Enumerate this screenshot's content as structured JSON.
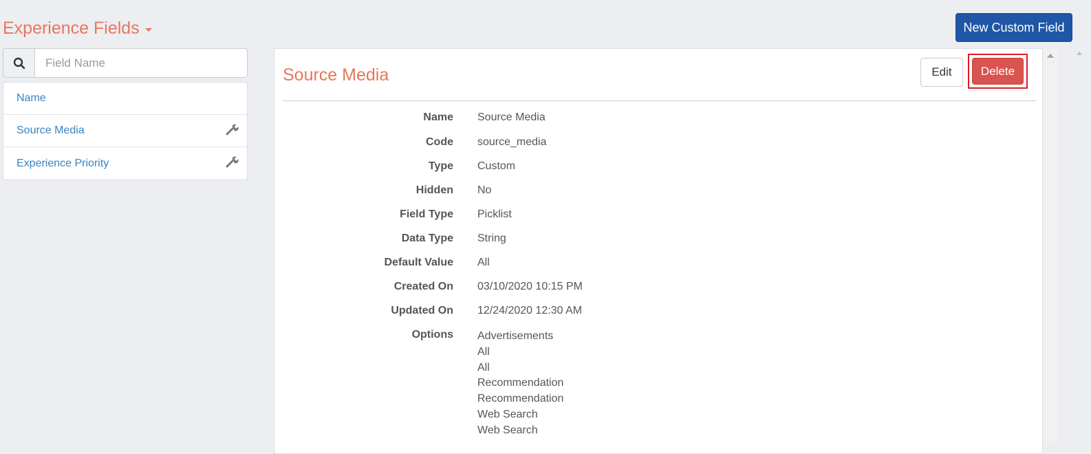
{
  "header": {
    "section_title": "Experience Fields",
    "new_button_label": "New Custom Field"
  },
  "sidebar": {
    "search_placeholder": "Field Name",
    "items": [
      {
        "label": "Name",
        "has_wrench": false
      },
      {
        "label": "Source Media",
        "has_wrench": true
      },
      {
        "label": "Experience Priority",
        "has_wrench": true
      }
    ]
  },
  "detail": {
    "title": "Source Media",
    "edit_label": "Edit",
    "delete_label": "Delete",
    "fields": [
      {
        "key": "Name",
        "value": "Source Media"
      },
      {
        "key": "Code",
        "value": "source_media"
      },
      {
        "key": "Type",
        "value": "Custom"
      },
      {
        "key": "Hidden",
        "value": "No"
      },
      {
        "key": "Field Type",
        "value": "Picklist"
      },
      {
        "key": "Data Type",
        "value": "String"
      },
      {
        "key": "Default Value",
        "value": "All"
      },
      {
        "key": "Created On",
        "value": "03/10/2020 10:15 PM"
      },
      {
        "key": "Updated On",
        "value": "12/24/2020 12:30 AM"
      }
    ],
    "options_label": "Options",
    "options": [
      "Advertisements",
      "All",
      "All",
      "Recommendation",
      "Recommendation",
      "Web Search",
      "Web Search"
    ]
  },
  "colors": {
    "accent": "#e8775a",
    "primary_button": "#1f56a5",
    "danger_button": "#d9534f",
    "link": "#3a83c0",
    "highlight_border": "#e01b24"
  },
  "icons": {
    "search": "search-icon",
    "wrench": "wrench-icon",
    "caret": "caret-down-icon"
  }
}
